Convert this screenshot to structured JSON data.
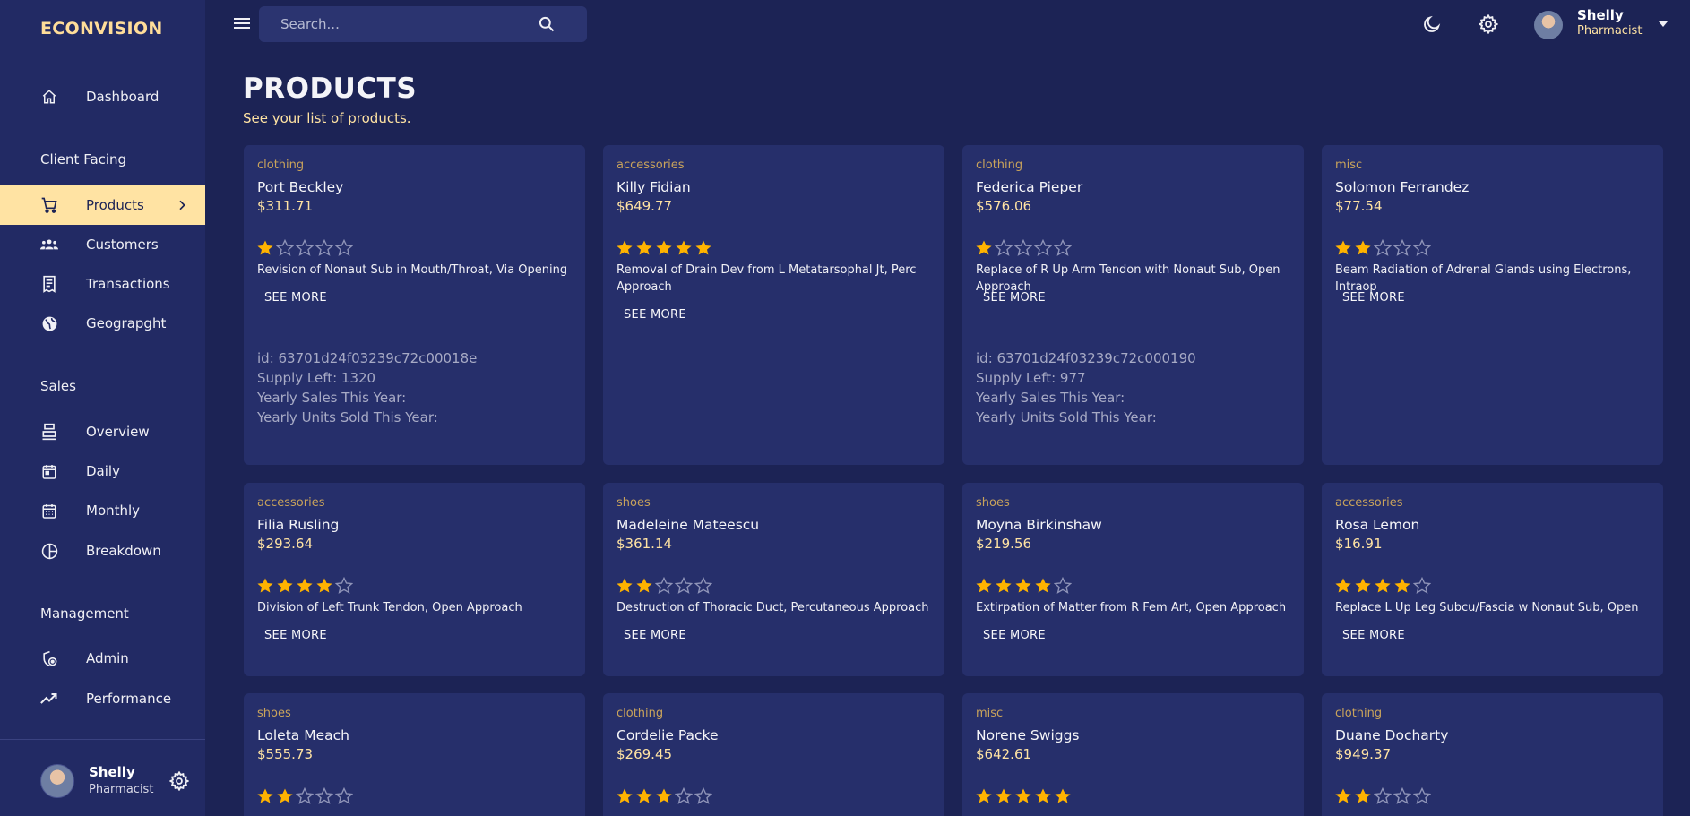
{
  "brand": "ECONVISION",
  "search": {
    "placeholder": "Search..."
  },
  "user": {
    "name": "Shelly",
    "role": "Pharmacist"
  },
  "nav": {
    "dashboard": "Dashboard",
    "section_client": "Client Facing",
    "products": "Products",
    "customers": "Customers",
    "transactions": "Transactions",
    "geography": "Geograpght",
    "section_sales": "Sales",
    "overview": "Overview",
    "daily": "Daily",
    "monthly": "Monthly",
    "breakdown": "Breakdown",
    "section_management": "Management",
    "admin": "Admin",
    "performance": "Performance"
  },
  "header": {
    "title": "PRODUCTS",
    "subtitle": "See your list of products."
  },
  "see_more_label": "SEE MORE",
  "colors": {
    "accent": "#ffe3a3",
    "star": "#ffb300",
    "background": "#1c2355",
    "card": "#262f6b"
  },
  "products": [
    {
      "category": "clothing",
      "name": "Port Beckley",
      "price": "$311.71",
      "rating": 1,
      "description": "Revision of Nonaut Sub in Mouth/Throat, Via Opening",
      "expanded": true,
      "id_text": "id: 63701d24f03239c72c00018e",
      "supply_text": "Supply Left: 1320",
      "yearly_sales_text": "Yearly Sales This Year:",
      "yearly_units_text": "Yearly Units Sold This Year:"
    },
    {
      "category": "accessories",
      "name": "Killy Fidian",
      "price": "$649.77",
      "rating": 5,
      "description": "Removal of Drain Dev from L Metatarsophal Jt, Perc Approach",
      "expanded": false
    },
    {
      "category": "clothing",
      "name": "Federica Pieper",
      "price": "$576.06",
      "rating": 1,
      "description": "Replace of R Up Arm Tendon with Nonaut Sub, Open Approach",
      "expanded": true,
      "id_text": "id: 63701d24f03239c72c000190",
      "supply_text": "Supply Left: 977",
      "yearly_sales_text": "Yearly Sales This Year:",
      "yearly_units_text": "Yearly Units Sold This Year:"
    },
    {
      "category": "misc",
      "name": "Solomon Ferrandez",
      "price": "$77.54",
      "rating": 2,
      "description": "Beam Radiation of Adrenal Glands using Electrons, Intraop",
      "expanded": false
    },
    {
      "category": "accessories",
      "name": "Filia Rusling",
      "price": "$293.64",
      "rating": 4,
      "description": "Division of Left Trunk Tendon, Open Approach",
      "expanded": false
    },
    {
      "category": "shoes",
      "name": "Madeleine Mateescu",
      "price": "$361.14",
      "rating": 2,
      "description": "Destruction of Thoracic Duct, Percutaneous Approach",
      "expanded": false
    },
    {
      "category": "shoes",
      "name": "Moyna Birkinshaw",
      "price": "$219.56",
      "rating": 4,
      "description": "Extirpation of Matter from R Fem Art, Open Approach",
      "expanded": false
    },
    {
      "category": "accessories",
      "name": "Rosa Lemon",
      "price": "$16.91",
      "rating": 4,
      "description": "Replace L Up Leg Subcu/Fascia w Nonaut Sub, Open",
      "expanded": false
    },
    {
      "category": "shoes",
      "name": "Loleta Meach",
      "price": "$555.73",
      "rating": 2,
      "description": "",
      "expanded": false
    },
    {
      "category": "clothing",
      "name": "Cordelie Packe",
      "price": "$269.45",
      "rating": 3,
      "description": "",
      "expanded": false
    },
    {
      "category": "misc",
      "name": "Norene Swiggs",
      "price": "$642.61",
      "rating": 5,
      "description": "",
      "expanded": false
    },
    {
      "category": "clothing",
      "name": "Duane Docharty",
      "price": "$949.37",
      "rating": 2,
      "description": "",
      "expanded": false
    }
  ]
}
